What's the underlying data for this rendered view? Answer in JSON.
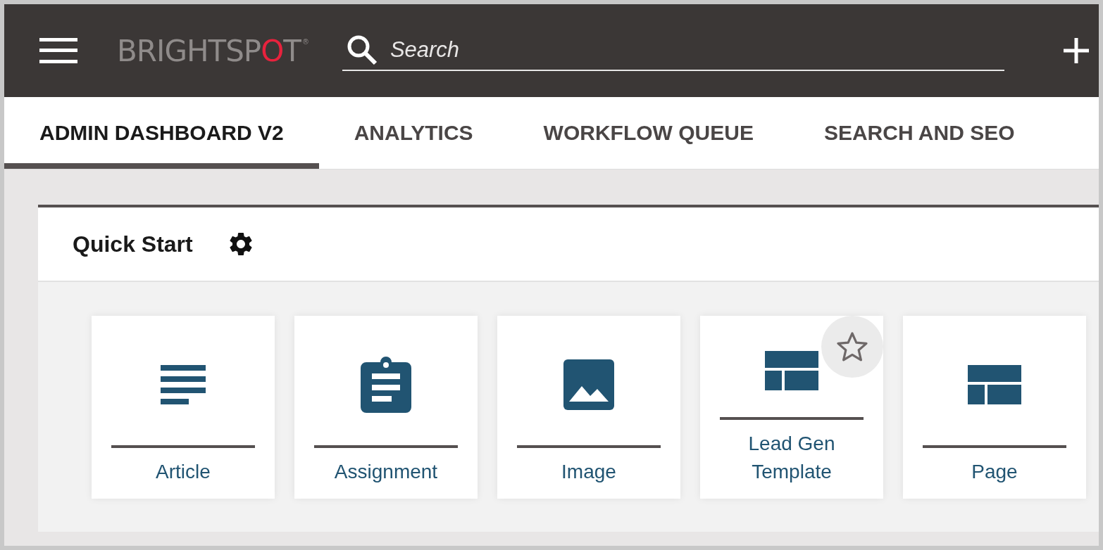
{
  "header": {
    "logo": {
      "parts": [
        {
          "text": "BRIGHTSP",
          "accent": false
        },
        {
          "text": "O",
          "accent": true
        },
        {
          "text": "T",
          "accent": false
        }
      ],
      "mark": "®"
    },
    "search": {
      "placeholder": "Search"
    }
  },
  "tabs": [
    {
      "label": "ADMIN DASHBOARD V2",
      "selected": true
    },
    {
      "label": "ANALYTICS",
      "selected": false
    },
    {
      "label": "WORKFLOW QUEUE",
      "selected": false
    },
    {
      "label": "SEARCH AND SEO",
      "selected": false
    }
  ],
  "quick_start": {
    "title": "Quick Start",
    "tiles": [
      {
        "kind": "article",
        "label": "Article",
        "hovered": false
      },
      {
        "kind": "assignment",
        "label": "Assignment",
        "hovered": false
      },
      {
        "kind": "image",
        "label": "Image",
        "hovered": false
      },
      {
        "kind": "template",
        "label": "Lead Gen Template",
        "hovered": true
      },
      {
        "kind": "page",
        "label": "Page",
        "hovered": false
      }
    ]
  }
}
